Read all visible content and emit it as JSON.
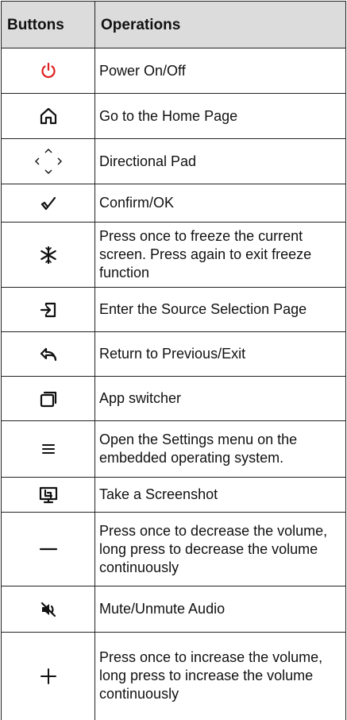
{
  "header": {
    "buttons": "Buttons",
    "operations": "Operations"
  },
  "rows": [
    {
      "icon": "power-icon",
      "text": "Power On/Off"
    },
    {
      "icon": "home-icon",
      "text": "Go to the Home Page"
    },
    {
      "icon": "directional-pad-icon",
      "text": "Directional Pad"
    },
    {
      "icon": "confirm-check-icon",
      "text": "Confirm/OK"
    },
    {
      "icon": "freeze-icon",
      "text": "Press once to freeze the current screen. Press again to exit freeze function"
    },
    {
      "icon": "source-input-icon",
      "text": "Enter the Source Selection Page"
    },
    {
      "icon": "return-icon",
      "text": "Return to Previous/Exit"
    },
    {
      "icon": "app-switcher-icon",
      "text": "App switcher"
    },
    {
      "icon": "settings-menu-icon",
      "text": "Open the Settings menu on the embedded operating system."
    },
    {
      "icon": "screenshot-icon",
      "text": "Take a Screenshot"
    },
    {
      "icon": "volume-down-icon",
      "text": "Press once to decrease the volume, long press to decrease the volume continuously"
    },
    {
      "icon": "mute-icon",
      "text": "Mute/Unmute Audio"
    },
    {
      "icon": "volume-up-icon",
      "text": "Press once to increase the volume, long press to increase the volume continuously"
    }
  ],
  "colors": {
    "header_bg": "#dcdcdc",
    "power_icon": "#e02020",
    "border": "#222222"
  }
}
